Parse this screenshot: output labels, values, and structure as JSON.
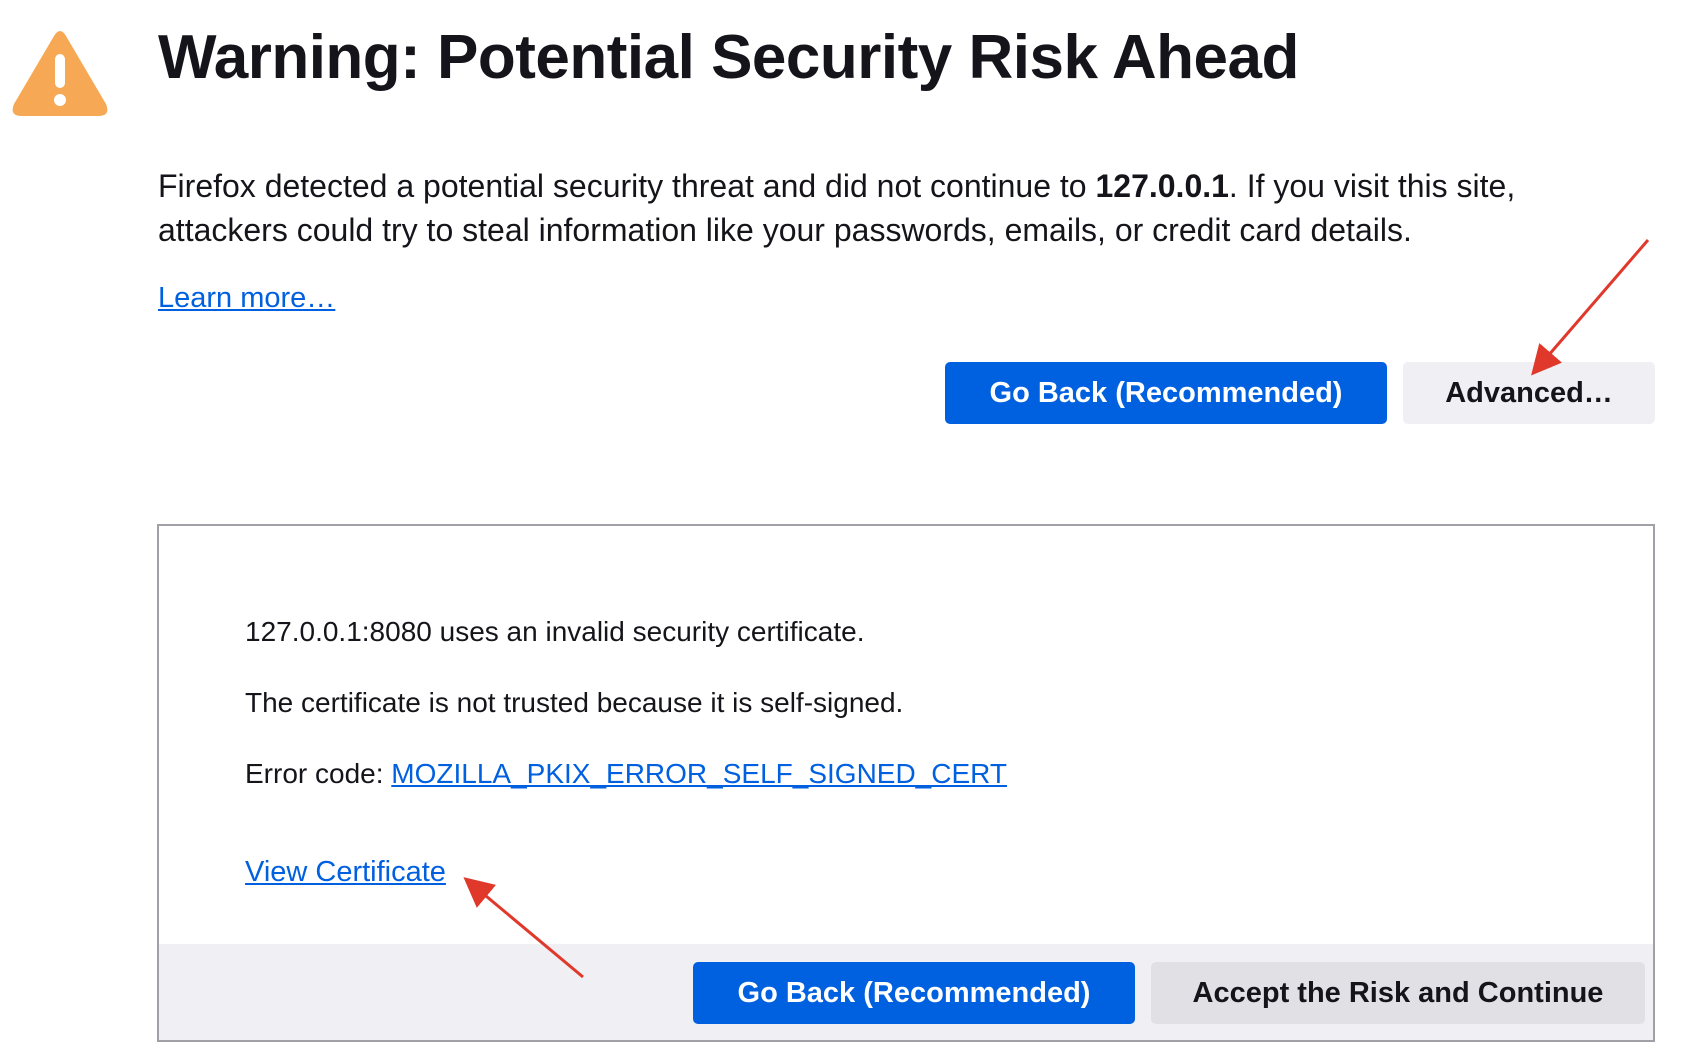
{
  "page": {
    "title": "Warning: Potential Security Risk Ahead",
    "intro_part1": "Firefox detected a potential security threat and did not continue to ",
    "intro_host": "127.0.0.1",
    "intro_part2": ". If you visit this site, attackers could try to steal information like your passwords, emails, or credit card details.",
    "learn_more": "Learn more…",
    "go_back_label": "Go Back (Recommended)",
    "advanced_label": "Advanced…"
  },
  "advanced": {
    "line1": "127.0.0.1:8080 uses an invalid security certificate.",
    "line2": "The certificate is not trusted because it is self-signed.",
    "error_prefix": "Error code: ",
    "error_code": "MOZILLA_PKIX_ERROR_SELF_SIGNED_CERT",
    "view_certificate": "View Certificate",
    "go_back_label": "Go Back (Recommended)",
    "accept_label": "Accept the Risk and Continue"
  },
  "icons": {
    "warning": "warning-triangle-icon",
    "annotation_arrow": "red-arrow"
  },
  "colors": {
    "warning_icon": "#f6a854",
    "primary_button": "#0061e0",
    "secondary_button": "#f0f0f4",
    "link": "#0060df",
    "annotation_arrow": "#e0392b"
  }
}
